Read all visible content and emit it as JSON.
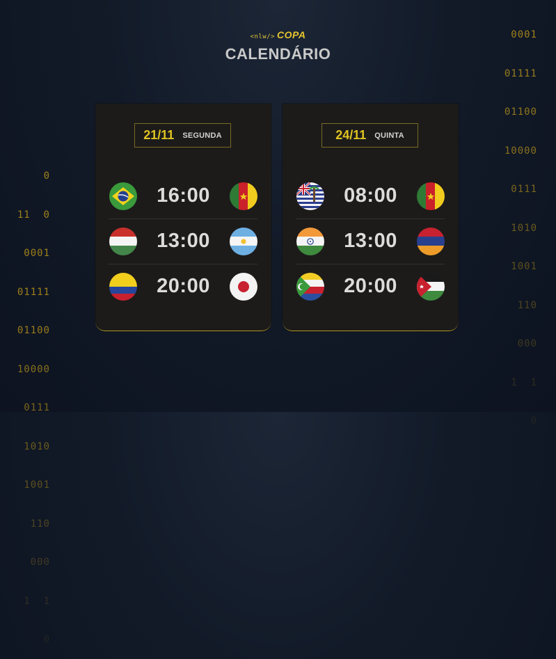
{
  "logo": {
    "tag": "<nlw/>",
    "word": "COPA"
  },
  "title": "CALENDÁRIO",
  "binary_left": [
    "0",
    "11  0",
    "0001",
    "01111",
    "01100",
    "10000",
    "0111",
    "1010",
    "1001",
    "110",
    "000",
    "1  1",
    "0"
  ],
  "binary_right": [
    "0001",
    "01111",
    "01100",
    "10000",
    "0111",
    "1010",
    "1001",
    "110",
    "000",
    "1  1",
    "0"
  ],
  "days": [
    {
      "date": "21/11",
      "weekday": "SEGUNDA",
      "matches": [
        {
          "home_flag": "brazil-flag-icon",
          "time": "16:00",
          "away_flag": "cameroon-flag-icon"
        },
        {
          "home_flag": "hungary-flag-icon",
          "time": "13:00",
          "away_flag": "argentina-flag-icon"
        },
        {
          "home_flag": "colombia-flag-icon",
          "time": "20:00",
          "away_flag": "japan-flag-icon"
        }
      ]
    },
    {
      "date": "24/11",
      "weekday": "QUINTA",
      "matches": [
        {
          "home_flag": "british-indian-ocean-territory-flag-icon",
          "time": "08:00",
          "away_flag": "cameroon-flag-icon"
        },
        {
          "home_flag": "india-flag-icon",
          "time": "13:00",
          "away_flag": "armenia-flag-icon"
        },
        {
          "home_flag": "comoros-flag-icon",
          "time": "20:00",
          "away_flag": "jordan-flag-icon"
        }
      ]
    }
  ],
  "colors": {
    "accent": "#e7c52e",
    "card_bg": "#1c1b1a",
    "time_text": "#dcdcdc",
    "binary": "#a7871a"
  }
}
